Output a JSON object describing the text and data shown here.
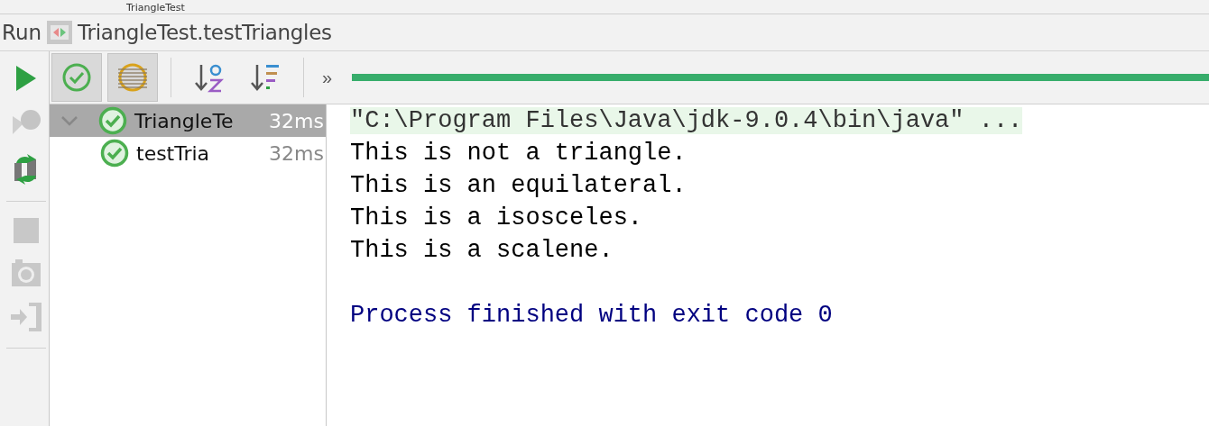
{
  "window": {
    "title": "TriangleTest"
  },
  "run_bar": {
    "label": "Run",
    "configuration": "TriangleTest.testTriangles"
  },
  "side_toolbar": [
    {
      "kind": "rerun",
      "disabled": false
    },
    {
      "kind": "rerun-failed",
      "disabled": true
    },
    {
      "kind": "toggle-auto-test",
      "disabled": false
    },
    {
      "kind": "stop",
      "disabled": true
    },
    {
      "kind": "dump-threads",
      "disabled": true
    },
    {
      "kind": "exit",
      "disabled": true
    }
  ],
  "toolbar": [
    {
      "kind": "show-passed",
      "selected": true
    },
    {
      "kind": "show-ignored",
      "selected": true
    },
    {
      "kind": "sort-alpha",
      "selected": false
    },
    {
      "kind": "sort-duration",
      "selected": false
    }
  ],
  "more": "»",
  "progress": {
    "level": 1
  },
  "tree": [
    {
      "name": "TriangleTe",
      "duration": "32ms",
      "expanded": true,
      "selected": true,
      "children": [
        {
          "name": "testTria",
          "duration": "32ms",
          "selected": false
        }
      ]
    }
  ],
  "console": [
    {
      "kind": "command",
      "text": "\"C:\\Program Files\\Java\\jdk-9.0.4\\bin\\java\" ..."
    },
    {
      "kind": "stdout",
      "text": "This is not a triangle."
    },
    {
      "kind": "stdout",
      "text": "This is an equilateral."
    },
    {
      "kind": "stdout",
      "text": "This is a isosceles."
    },
    {
      "kind": "stdout",
      "text": "This is a scalene."
    },
    {
      "kind": "blank"
    },
    {
      "kind": "system",
      "text": "Process finished with exit code 0"
    }
  ]
}
